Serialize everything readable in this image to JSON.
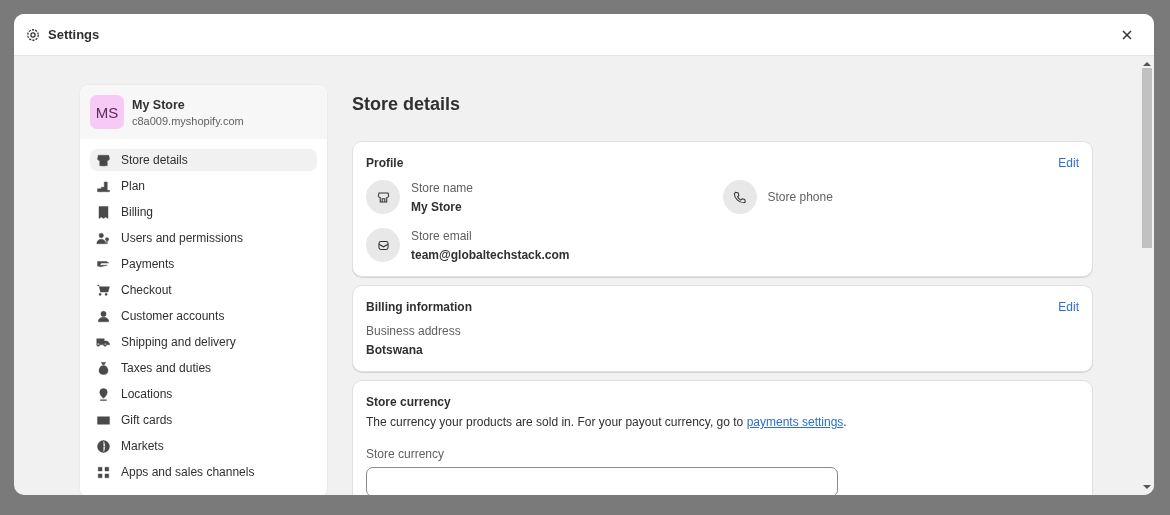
{
  "window": {
    "title": "Settings"
  },
  "store": {
    "initials": "MS",
    "name": "My Store",
    "domain": "c8a009.myshopify.com"
  },
  "sidebar": {
    "items": [
      {
        "label": "Store details",
        "selected": true
      },
      {
        "label": "Plan",
        "selected": false
      },
      {
        "label": "Billing",
        "selected": false
      },
      {
        "label": "Users and permissions",
        "selected": false
      },
      {
        "label": "Payments",
        "selected": false
      },
      {
        "label": "Checkout",
        "selected": false
      },
      {
        "label": "Customer accounts",
        "selected": false
      },
      {
        "label": "Shipping and delivery",
        "selected": false
      },
      {
        "label": "Taxes and duties",
        "selected": false
      },
      {
        "label": "Locations",
        "selected": false
      },
      {
        "label": "Gift cards",
        "selected": false
      },
      {
        "label": "Markets",
        "selected": false
      },
      {
        "label": "Apps and sales channels",
        "selected": false
      }
    ]
  },
  "page_title": "Store details",
  "profile": {
    "title": "Profile",
    "edit": "Edit",
    "fields": [
      {
        "kind": "store",
        "label": "Store name",
        "value": "My Store"
      },
      {
        "kind": "phone",
        "label": "Store phone"
      },
      {
        "kind": "email",
        "label": "Store email",
        "value": "team@globaltechstack.com"
      }
    ]
  },
  "billing": {
    "title": "Billing information",
    "edit": "Edit",
    "label": "Business address",
    "value": "Botswana"
  },
  "currency": {
    "title": "Store currency",
    "description": "The currency your products are sold in. For your payout currency, go to ",
    "link": "payments settings",
    "after": ".",
    "field_label": "Store currency"
  }
}
